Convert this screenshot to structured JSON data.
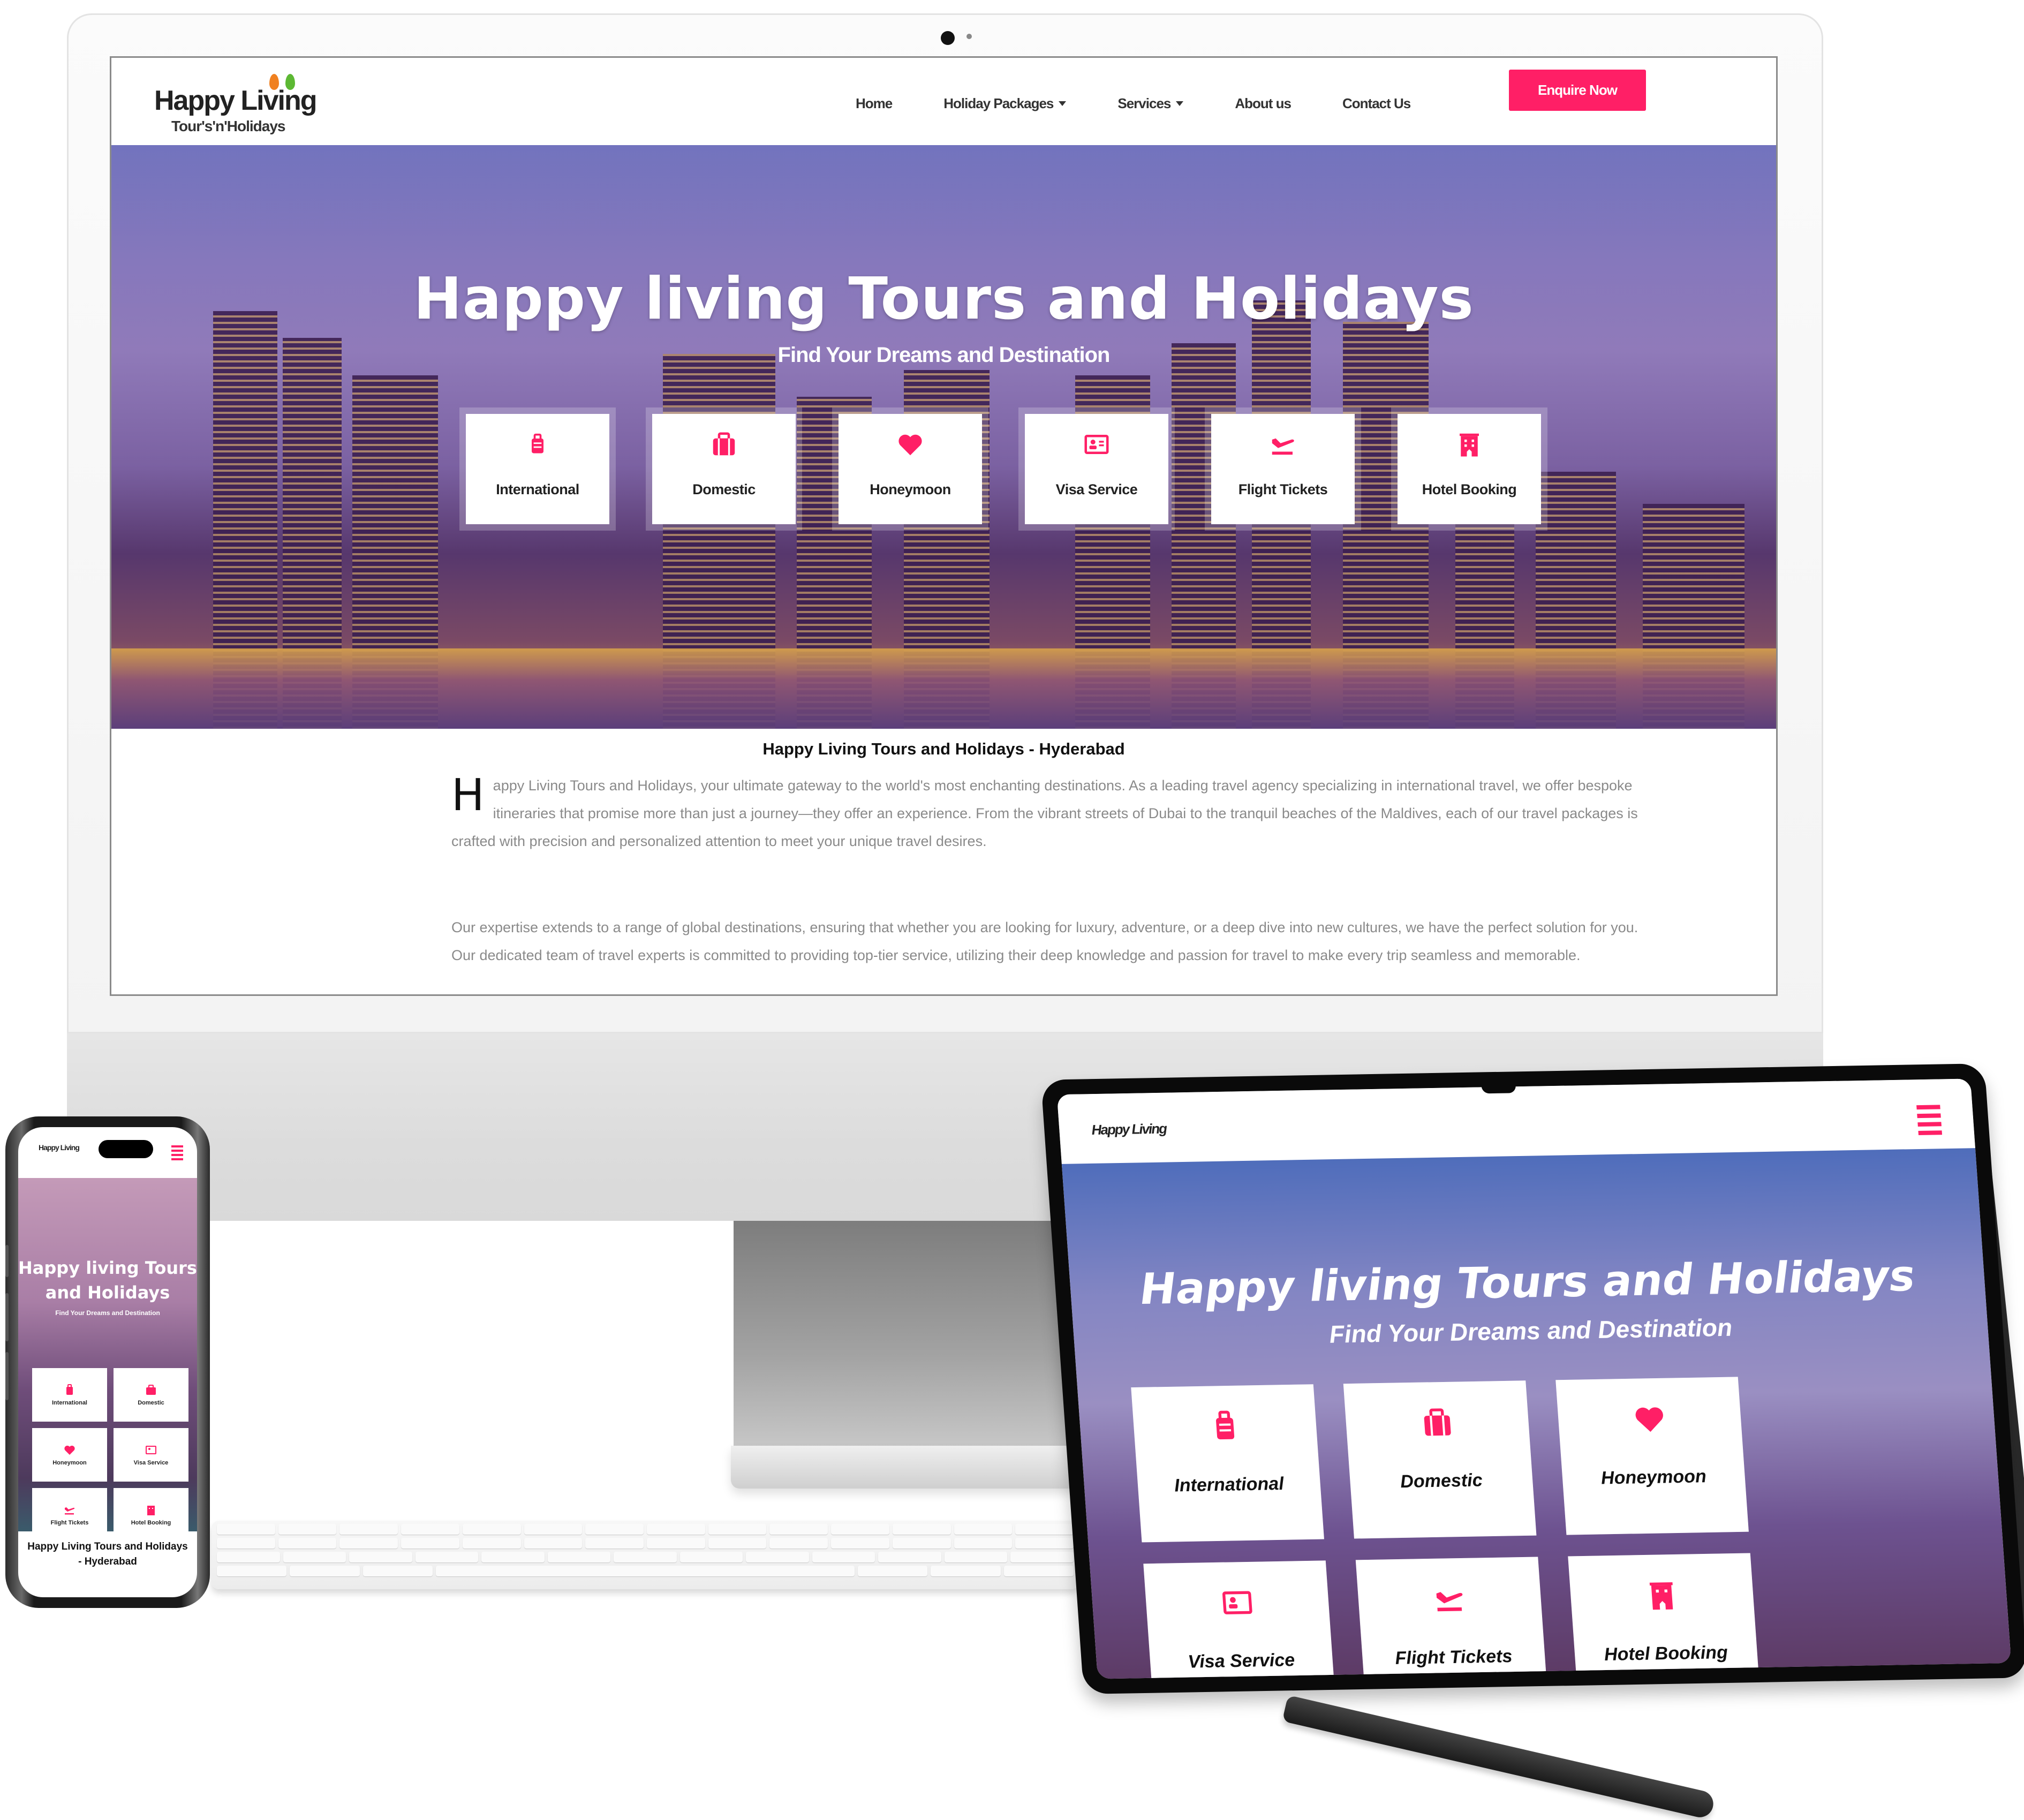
{
  "brand": {
    "name": "Happy Living",
    "tagline": "Tour's'n'Holidays",
    "accent_color": "#ff1f66"
  },
  "desktop": {
    "nav": {
      "links": [
        {
          "label": "Home",
          "has_dropdown": false
        },
        {
          "label": "Holiday Packages",
          "has_dropdown": true
        },
        {
          "label": "Services",
          "has_dropdown": true
        },
        {
          "label": "About us",
          "has_dropdown": false
        },
        {
          "label": "Contact Us",
          "has_dropdown": false
        }
      ],
      "cta_label": "Enquire Now"
    },
    "hero": {
      "title": "Happy living Tours and Holidays",
      "subtitle": "Find Your Dreams and Destination"
    },
    "services": [
      {
        "label": "International",
        "icon": "suitcase-rolling-icon"
      },
      {
        "label": "Domestic",
        "icon": "briefcase-icon"
      },
      {
        "label": "Honeymoon",
        "icon": "heart-icon"
      },
      {
        "label": "Visa Service",
        "icon": "id-card-icon"
      },
      {
        "label": "Flight Tickets",
        "icon": "plane-arrival-icon"
      },
      {
        "label": "Hotel Booking",
        "icon": "hotel-icon"
      }
    ],
    "content": {
      "title": "Happy Living Tours and Holidays - Hyderabad",
      "dropcap": "H",
      "paragraph1": "appy Living Tours and Holidays, your ultimate gateway to the world's most enchanting destinations. As a leading travel agency specializing in international travel, we offer bespoke itineraries that promise more than just a journey—they offer an experience. From the vibrant streets of Dubai to the tranquil beaches of the Maldives, each of our travel packages is crafted with precision and personalized attention to meet your unique travel desires.",
      "paragraph2": "Our expertise extends to a range of global destinations, ensuring that whether you are looking for luxury, adventure, or a deep dive into new cultures, we have the perfect solution for you. Our dedicated team of travel experts is committed to providing top-tier service, utilizing their deep knowledge and passion for travel to make every trip seamless and memorable."
    }
  },
  "phone": {
    "hero_title_line1": "Happy living Tours",
    "hero_title_line2": "and Holidays",
    "hero_subtitle": "Find Your Dreams and Destination",
    "content_title_line1": "Happy Living Tours and Holidays",
    "content_title_line2": "- Hyderabad",
    "menu_icon": "hamburger-icon"
  },
  "tablet": {
    "hero_title": "Happy living Tours and Holidays",
    "hero_subtitle": "Find Your Dreams and Destination",
    "menu_icon": "hamburger-icon"
  }
}
